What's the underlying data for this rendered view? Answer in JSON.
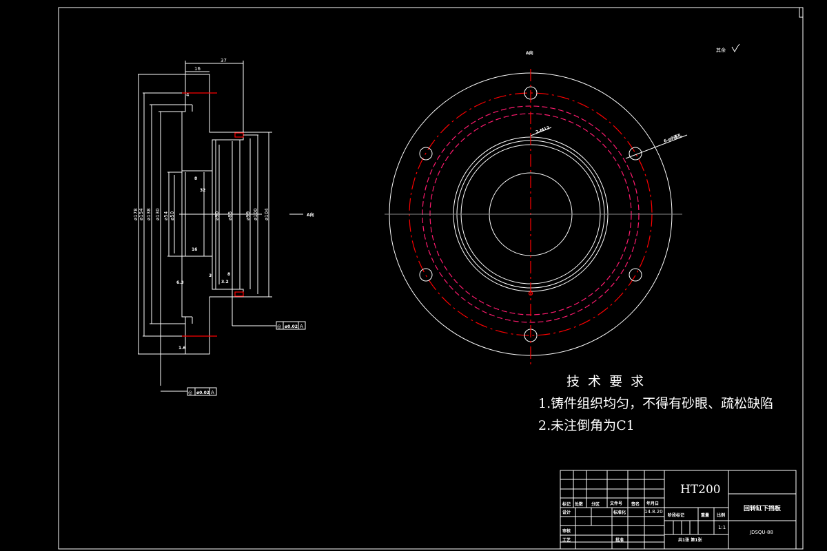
{
  "colors": {
    "background": "#000000",
    "lines": "#ffffff",
    "centerlines": "#ff0000",
    "hidden": "#ff1a6e"
  },
  "section_view": {
    "dims_top": [
      "37",
      "16",
      "4"
    ],
    "dims_vertical": [
      "ø178",
      "ø154",
      "ø138",
      "ø130",
      "ø54",
      "ø50",
      "ø90",
      "ø85",
      "ø99",
      "ø100",
      "ø104"
    ],
    "small_dims": [
      "8",
      "32",
      "16",
      "3",
      "8",
      "6.3",
      "3.2",
      "1.6"
    ],
    "view_arrow": "A向",
    "tolerance_frames": [
      {
        "symbol": "◎",
        "value": "ø0.02",
        "datum": "A"
      },
      {
        "symbol": "◎",
        "value": "ø0.02",
        "datum": "A"
      }
    ]
  },
  "end_view": {
    "label": "A向",
    "hole_callout_1": "2-M12",
    "hole_callout_2": "6-ø9通孔",
    "roughness_note": "其余"
  },
  "tech_requirements": {
    "title": "技 术  要 求",
    "items": [
      "1.铸件组织均匀，不得有砂眼、疏松缺陷",
      "2.未注倒角为C1"
    ]
  },
  "title_block": {
    "material": "HT200",
    "part_name": "回转缸下挡板",
    "drawing_no": "JDSQU-88",
    "headers": [
      "标记",
      "处数",
      "分区",
      "文件号",
      "签名",
      "年月日"
    ],
    "designer_label": "设计",
    "standardization_label": "标准化",
    "date": "14.8.20",
    "reviewer_label": "审核",
    "process_label": "工艺",
    "approve_label": "批准",
    "stage_label": "阶段标记",
    "weight_label": "重量",
    "scale_label": "比例",
    "scale": "1:1",
    "sheets": "共1张 第1张"
  }
}
